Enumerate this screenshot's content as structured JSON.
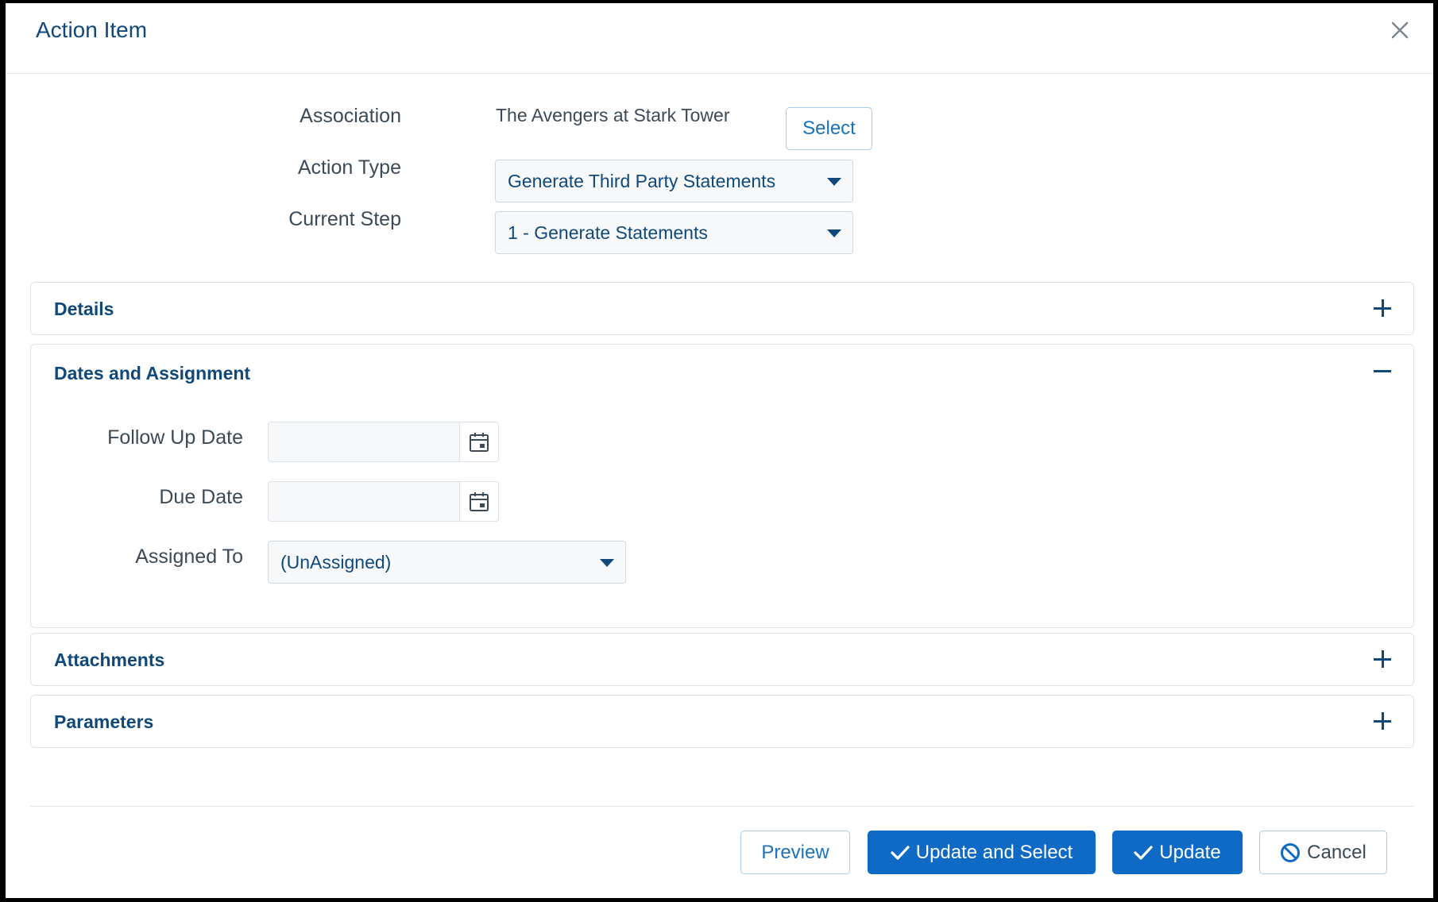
{
  "dialog": {
    "title": "Action Item"
  },
  "association": {
    "label": "Association",
    "value": "The Avengers at Stark Tower",
    "select_button": "Select"
  },
  "action_type": {
    "label": "Action Type",
    "value": "Generate Third Party Statements"
  },
  "current_step": {
    "label": "Current Step",
    "value": "1 - Generate Statements"
  },
  "sections": {
    "details": {
      "title": "Details",
      "state": "collapsed"
    },
    "dates": {
      "title": "Dates and Assignment",
      "state": "expanded",
      "follow_up_label": "Follow Up Date",
      "follow_up_value": "",
      "due_label": "Due Date",
      "due_value": "",
      "assigned_label": "Assigned To",
      "assigned_value": "(UnAssigned)"
    },
    "attachments": {
      "title": "Attachments",
      "state": "collapsed"
    },
    "parameters": {
      "title": "Parameters",
      "state": "collapsed"
    }
  },
  "footer": {
    "preview": "Preview",
    "update_and_select": "Update and Select",
    "update": "Update",
    "cancel": "Cancel"
  },
  "colors": {
    "accent": "#0f6ac6",
    "heading": "#10487a",
    "text": "#3c4a57"
  },
  "icons": [
    "close-icon",
    "chevron-down-icon",
    "plus-icon",
    "minus-icon",
    "calendar-icon",
    "check-icon",
    "ban-icon"
  ]
}
